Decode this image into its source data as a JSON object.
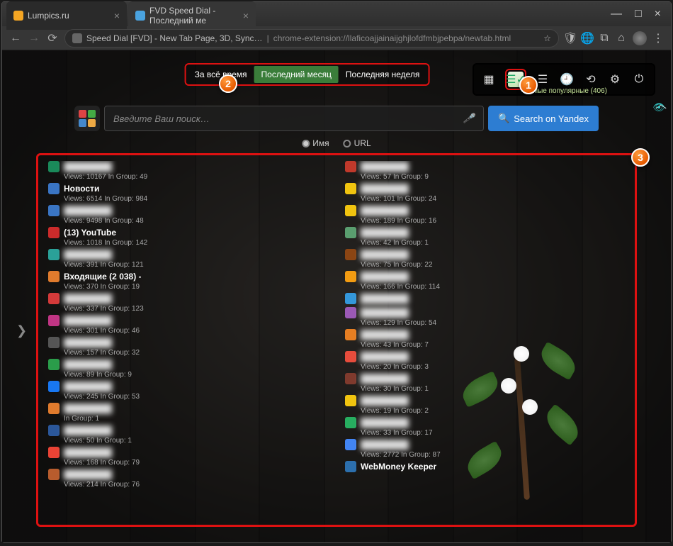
{
  "window": {
    "tabs": [
      {
        "title": "Lumpics.ru",
        "fav_color": "#f5a623"
      },
      {
        "title": "FVD Speed Dial - Последний ме",
        "fav_color": "#4aa3e0"
      }
    ],
    "min": "—",
    "max": "□",
    "close": "×"
  },
  "url": {
    "prefix": "Speed Dial [FVD] - New Tab Page, 3D, Sync…",
    "path": "chrome-extension://llaficoajjainaijghjlofdfmbjpebpa/newtab.html",
    "star": "☆"
  },
  "period": {
    "all": "За всё время",
    "month": "Последний месяц",
    "week": "Последняя неделя"
  },
  "popular_label": "мые популярные (406)",
  "search": {
    "placeholder": "Введите Ваш поиск…",
    "button": "Search on Yandex",
    "icon": "🔍"
  },
  "radios": {
    "name": "Имя",
    "url": "URL"
  },
  "callouts": {
    "c1": "1",
    "c2": "2",
    "c3": "3"
  },
  "left": [
    {
      "name": "",
      "views": "10167",
      "group": "49",
      "fav": "#1a8a5a",
      "blur": true
    },
    {
      "name": "Новости",
      "views": "6514",
      "group": "984",
      "fav": "#3a75c4"
    },
    {
      "name": "",
      "views": "9498",
      "group": "48",
      "fav": "#3a75c4",
      "blur": true
    },
    {
      "name": "(13) YouTube",
      "views": "1018",
      "group": "142",
      "fav": "#cc2b2b"
    },
    {
      "name": "",
      "views": "391",
      "group": "121",
      "fav": "#2aa198",
      "blur": true
    },
    {
      "name": "Входящие (2 038) -",
      "views": "370",
      "group": "19",
      "fav": "#e07b2d"
    },
    {
      "name": "",
      "views": "337",
      "group": "123",
      "fav": "#d43a3a",
      "blur": true
    },
    {
      "name": "",
      "views": "301",
      "group": "46",
      "fav": "#c13584",
      "blur": true
    },
    {
      "name": "",
      "views": "157",
      "group": "32",
      "fav": "#555",
      "blur": true
    },
    {
      "name": "",
      "views": "89",
      "group": "9",
      "fav": "#2a9d4a",
      "blur": true
    },
    {
      "name": "",
      "views": "245",
      "group": "53",
      "fav": "#1877f2",
      "blur": true
    },
    {
      "name": "",
      "views": "",
      "group": "1",
      "fav": "#e07b2d",
      "blur": true
    },
    {
      "name": "",
      "views": "50",
      "group": "1",
      "fav": "#2b579a",
      "blur": true
    },
    {
      "name": "",
      "views": "168",
      "group": "79",
      "fav": "#ea4335",
      "blur": true
    },
    {
      "name": "",
      "views": "214",
      "group": "76",
      "fav": "#b85c2d",
      "blur": true
    }
  ],
  "right": [
    {
      "name": "",
      "views": "57",
      "group": "9",
      "fav": "#c0392b",
      "blur": true
    },
    {
      "name": "",
      "views": "101",
      "group": "24",
      "fav": "#f1c40f",
      "blur": true
    },
    {
      "name": "",
      "views": "189",
      "group": "16",
      "fav": "#f1c40f",
      "blur": true
    },
    {
      "name": "",
      "views": "42",
      "group": "1",
      "fav": "#5a9e6f",
      "blur": true
    },
    {
      "name": "",
      "views": "75",
      "group": "22",
      "fav": "#8b4513",
      "blur": true
    },
    {
      "name": "",
      "views": "166",
      "group": "114",
      "fav": "#f39c12",
      "blur": true
    },
    {
      "name": "",
      "views": "",
      "group": "",
      "fav": "#3498db",
      "blur": true
    },
    {
      "name": "",
      "views": "129",
      "group": "54",
      "fav": "#9b59b6",
      "blur": true
    },
    {
      "name": "",
      "views": "43",
      "group": "7",
      "fav": "#e67e22",
      "blur": true
    },
    {
      "name": "",
      "views": "20",
      "group": "3",
      "fav": "#e74c3c",
      "blur": true
    },
    {
      "name": "",
      "views": "30",
      "group": "1",
      "fav": "#7f3a2d",
      "blur": true
    },
    {
      "name": "",
      "views": "19",
      "group": "2",
      "fav": "#f1c40f",
      "blur": true
    },
    {
      "name": "",
      "views": "33",
      "group": "17",
      "fav": "#27ae60",
      "blur": true
    },
    {
      "name": "",
      "views": "2772",
      "group": "87",
      "fav": "#4285f4",
      "blur": true
    },
    {
      "name": "WebMoney Keeper",
      "views": "",
      "group": "",
      "fav": "#2c6fad"
    }
  ],
  "stat_labels": {
    "views": "Views:",
    "group": "In Group:"
  }
}
